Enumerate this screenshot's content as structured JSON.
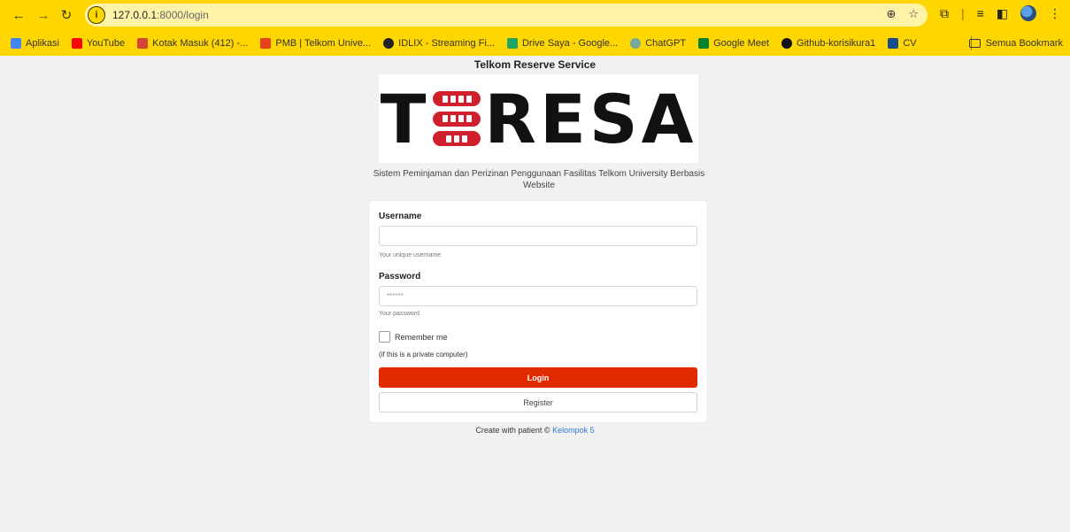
{
  "browser": {
    "url_host": "127.0.0.1",
    "url_path": ":8000/login",
    "bookmarks": [
      {
        "label": "Aplikasi",
        "color": "#f4b400"
      },
      {
        "label": "YouTube",
        "color": "#ff0000"
      },
      {
        "label": "Kotak Masuk (412) -...",
        "color": "#d44638"
      },
      {
        "label": "PMB | Telkom Unive...",
        "color": "#e8421d"
      },
      {
        "label": "IDLIX - Streaming Fi...",
        "color": "#222222"
      },
      {
        "label": "Drive Saya - Google...",
        "color": "#1fa463"
      },
      {
        "label": "ChatGPT",
        "color": "#74aa9c"
      },
      {
        "label": "Google Meet",
        "color": "#00832d"
      },
      {
        "label": "Github-korisikura1",
        "color": "#111111"
      },
      {
        "label": "CV",
        "color": "#1a4c8c"
      }
    ],
    "all_bookmarks_label": "Semua Bookmark"
  },
  "page": {
    "title": "Telkom Reserve Service",
    "logo": {
      "left": "T",
      "right": "RESA"
    },
    "subtitle": "Sistem Peminjaman dan Perizinan Penggunaan Fasilitas Telkom University Berbasis Website"
  },
  "form": {
    "username_label": "Username",
    "username_value": "",
    "username_help": "Your unique username",
    "password_label": "Password",
    "password_placeholder": "******",
    "password_help": "Your password",
    "remember_label": "Remember me",
    "remember_note": "(if this is a private computer)",
    "login_label": "Login",
    "register_label": "Register"
  },
  "footer": {
    "text": "Create with patient © ",
    "link": "Kelompok 5"
  },
  "colors": {
    "chrome": "#ffd600",
    "login_button": "#e02a00",
    "link": "#2a7ad5",
    "logo_red": "#d0202d"
  }
}
